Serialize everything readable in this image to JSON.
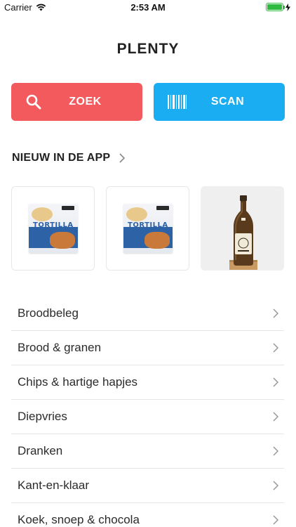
{
  "status_bar": {
    "carrier": "Carrier",
    "time": "2:53 AM",
    "battery_level": 1.0,
    "wifi_icon": "wifi-icon",
    "battery_icon": "battery-icon"
  },
  "app": {
    "title": "PLENTY"
  },
  "actions": {
    "search": {
      "label": "ZOEK",
      "icon": "search-icon",
      "color": "#f25a5d"
    },
    "scan": {
      "label": "SCAN",
      "icon": "barcode-icon",
      "color": "#1badf2"
    }
  },
  "new_section": {
    "title": "NIEUW IN DE APP",
    "products": [
      {
        "kind": "tortilla-pack",
        "pack_text": "TORTILLA"
      },
      {
        "kind": "tortilla-pack",
        "pack_text": "TORTILLA"
      },
      {
        "kind": "beer-bottle"
      }
    ]
  },
  "categories": [
    "Broodbeleg",
    "Brood & granen",
    "Chips & hartige hapjes",
    "Diepvries",
    "Dranken",
    "Kant-en-klaar",
    "Koek, snoep & chocola"
  ]
}
